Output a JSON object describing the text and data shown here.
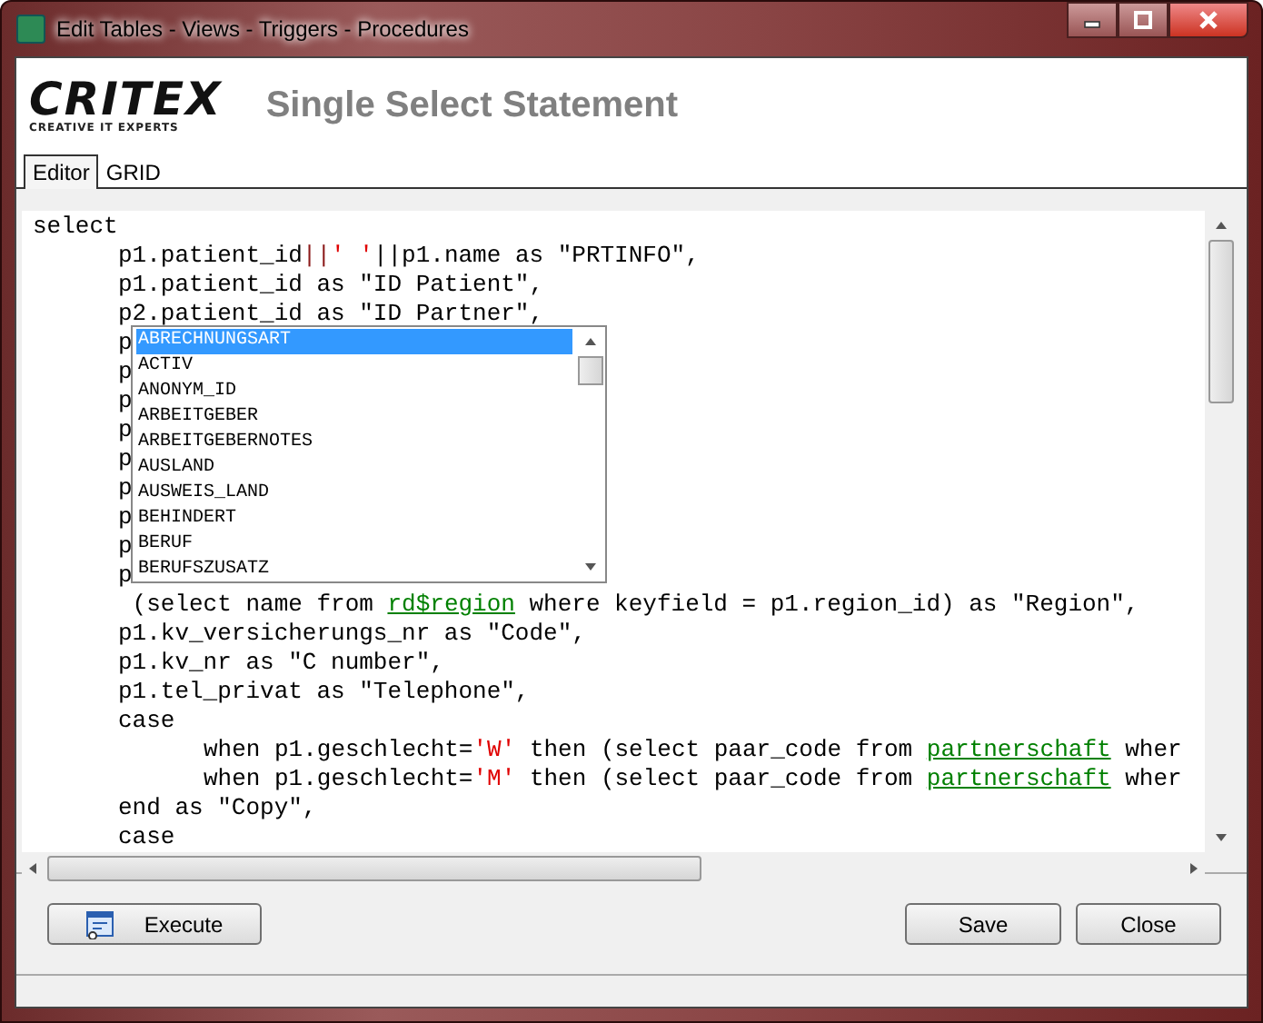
{
  "window": {
    "title": "Edit Tables - Views - Triggers - Procedures"
  },
  "header": {
    "logo": "CRITEX",
    "logo_tagline": "CREATIVE IT EXPERTS",
    "title": "Single Select Statement"
  },
  "tabs": [
    {
      "label": "Editor",
      "selected": true
    },
    {
      "label": "GRID",
      "selected": false
    }
  ],
  "code_lines": [
    {
      "kind": "top",
      "tokens": [
        {
          "kind": "plain",
          "text": "select"
        }
      ]
    },
    {
      "kind": "inner",
      "tokens": [
        {
          "kind": "plain",
          "text": "p1.patient_id"
        },
        {
          "kind": "operator",
          "text": "||"
        },
        {
          "kind": "string",
          "text": "' '"
        },
        {
          "kind": "plain",
          "text": "||p1.name as \"PRTINFO\","
        }
      ]
    },
    {
      "kind": "inner",
      "tokens": [
        {
          "kind": "plain",
          "text": "p1.patient_id as \"ID Patient\","
        }
      ]
    },
    {
      "kind": "inner",
      "tokens": [
        {
          "kind": "plain",
          "text": "p2.patient_id as \"ID Partner\","
        }
      ]
    },
    {
      "kind": "inner",
      "tokens": [
        {
          "kind": "plain",
          "text": "p"
        }
      ]
    },
    {
      "kind": "inner",
      "tokens": [
        {
          "kind": "plain",
          "text": "p"
        }
      ]
    },
    {
      "kind": "inner",
      "tokens": [
        {
          "kind": "plain",
          "text": "p"
        }
      ]
    },
    {
      "kind": "inner",
      "tokens": [
        {
          "kind": "plain",
          "text": "p"
        }
      ]
    },
    {
      "kind": "inner",
      "tokens": [
        {
          "kind": "plain",
          "text": "p"
        }
      ]
    },
    {
      "kind": "inner",
      "tokens": [
        {
          "kind": "plain",
          "text": "p"
        }
      ]
    },
    {
      "kind": "inner",
      "tokens": [
        {
          "kind": "plain",
          "text": "p"
        }
      ]
    },
    {
      "kind": "inner",
      "tokens": [
        {
          "kind": "plain",
          "text": "p"
        }
      ]
    },
    {
      "kind": "inner",
      "tokens": [
        {
          "kind": "plain",
          "text": "p"
        }
      ]
    },
    {
      "kind": "inner",
      "tokens": [
        {
          "kind": "plain",
          "text": " (select name from "
        },
        {
          "kind": "table",
          "text": "rd$region"
        },
        {
          "kind": "plain",
          "text": " where keyfield = p1.region_id) as \"Region\","
        }
      ]
    },
    {
      "kind": "inner",
      "tokens": [
        {
          "kind": "plain",
          "text": "p1.kv_versicherungs_nr as \"Code\","
        }
      ]
    },
    {
      "kind": "inner",
      "tokens": [
        {
          "kind": "plain",
          "text": "p1.kv_nr as \"C number\","
        }
      ]
    },
    {
      "kind": "inner",
      "tokens": [
        {
          "kind": "plain",
          "text": "p1.tel_privat as \"Telephone\","
        }
      ]
    },
    {
      "kind": "inner",
      "tokens": [
        {
          "kind": "plain",
          "text": "case"
        }
      ]
    },
    {
      "kind": "nested",
      "tokens": [
        {
          "kind": "plain",
          "text": "when p1.geschlecht="
        },
        {
          "kind": "string",
          "text": "'W'"
        },
        {
          "kind": "plain",
          "text": " then (select paar_code from "
        },
        {
          "kind": "table",
          "text": "partnerschaft"
        },
        {
          "kind": "plain",
          "text": " wher"
        }
      ]
    },
    {
      "kind": "nested",
      "tokens": [
        {
          "kind": "plain",
          "text": "when p1.geschlecht="
        },
        {
          "kind": "string",
          "text": "'M'"
        },
        {
          "kind": "plain",
          "text": " then (select paar_code from "
        },
        {
          "kind": "table",
          "text": "partnerschaft"
        },
        {
          "kind": "plain",
          "text": " wher"
        }
      ]
    },
    {
      "kind": "inner",
      "tokens": [
        {
          "kind": "plain",
          "text": "end as \"Copy\","
        }
      ]
    },
    {
      "kind": "inner",
      "tokens": [
        {
          "kind": "plain",
          "text": "case"
        }
      ]
    }
  ],
  "completion_list": [
    {
      "label": "ABRECHNUNGSART",
      "selected": true
    },
    {
      "label": "ACTIV",
      "selected": false
    },
    {
      "label": "ANONYM_ID",
      "selected": false
    },
    {
      "label": "ARBEITGEBER",
      "selected": false
    },
    {
      "label": "ARBEITGEBERNOTES",
      "selected": false
    },
    {
      "label": "AUSLAND",
      "selected": false
    },
    {
      "label": "AUSWEIS_LAND",
      "selected": false
    },
    {
      "label": "BEHINDERT",
      "selected": false
    },
    {
      "label": "BERUF",
      "selected": false
    },
    {
      "label": "BERUFSZUSATZ",
      "selected": false
    }
  ],
  "buttons": {
    "left": [
      {
        "label": "Execute"
      }
    ],
    "right": [
      {
        "label": "Save"
      },
      {
        "label": "Close"
      }
    ]
  }
}
